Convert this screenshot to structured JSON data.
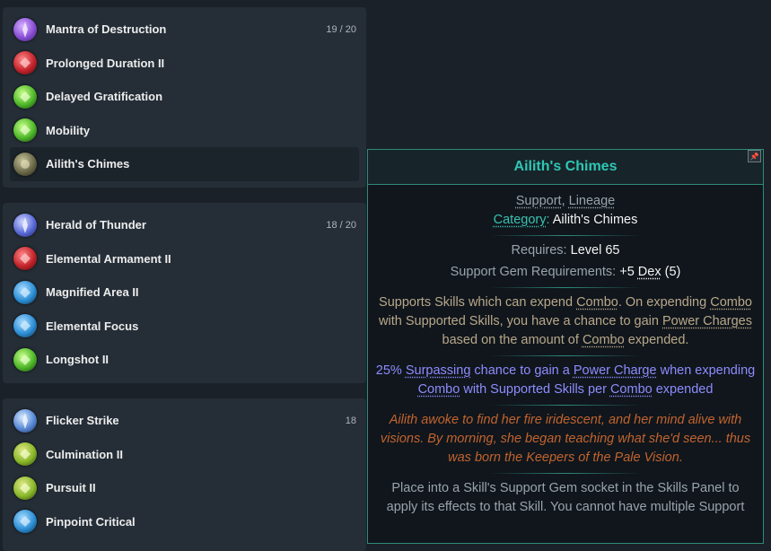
{
  "groups": [
    {
      "count": "19 / 20",
      "items": [
        {
          "name": "Mantra of Destruction",
          "icon": "purple-skill-gem-icon"
        },
        {
          "name": "Prolonged Duration II",
          "icon": "red-support-gem-icon"
        },
        {
          "name": "Delayed Gratification",
          "icon": "green-support-gem-icon"
        },
        {
          "name": "Mobility",
          "icon": "green-support-gem-icon"
        },
        {
          "name": "Ailith's Chimes",
          "icon": "lineage-support-gem-icon"
        }
      ]
    },
    {
      "count": "18 / 20",
      "items": [
        {
          "name": "Herald of Thunder",
          "icon": "blue-skill-gem-icon"
        },
        {
          "name": "Elemental Armament II",
          "icon": "red-support-gem-icon"
        },
        {
          "name": "Magnified Area II",
          "icon": "blue-support-gem-icon"
        },
        {
          "name": "Elemental Focus",
          "icon": "blue-support-gem-icon"
        },
        {
          "name": "Longshot II",
          "icon": "green-support-gem-icon"
        }
      ]
    },
    {
      "count": "18",
      "items": [
        {
          "name": "Flicker Strike",
          "icon": "blue-skill-gem-icon"
        },
        {
          "name": "Culmination II",
          "icon": "green-support-gem-icon"
        },
        {
          "name": "Pursuit II",
          "icon": "green-support-gem-icon"
        },
        {
          "name": "Pinpoint Critical",
          "icon": "blue-support-gem-icon"
        }
      ]
    }
  ],
  "tooltip": {
    "title": "Ailith's Chimes",
    "pin_icon": "pin-icon",
    "tags_support": "Support",
    "tags_sep": ", ",
    "tags_lineage": "Lineage",
    "category_label": "Category",
    "category_colon": ": ",
    "category_value": "Ailith's Chimes",
    "requires_label": "Requires: ",
    "requires_value": "Level 65",
    "gem_req_label": "Support Gem Requirements: ",
    "gem_req_value": "+5 ",
    "gem_req_stat": "Dex",
    "gem_req_extra": " (5)",
    "desc_1": "Supports Skills which can expend ",
    "desc_combo1": "Combo",
    "desc_2": ". On expending ",
    "desc_combo2": "Combo",
    "desc_3": " with Supported Skills, you have a chance to gain ",
    "desc_power": "Power Charges",
    "desc_4": " based on the amount of ",
    "desc_combo3": "Combo",
    "desc_5": " expended.",
    "mod_1": "25% ",
    "mod_surpassing": "Surpassing",
    "mod_2": " chance to gain a ",
    "mod_power": "Power Charge",
    "mod_3": " when expending ",
    "mod_combo1": "Combo",
    "mod_4": " with Supported Skills per ",
    "mod_combo2": "Combo",
    "mod_5": " expended",
    "lore": "Ailith awoke to find her fire iridescent, and her mind alive with visions. By morning, she began teaching what she'd seen... thus was born the Keepers of the Pale Vision.",
    "help": "Place into a Skill's Support Gem socket in the Skills Panel to apply its effects to that Skill. You cannot have multiple Support"
  },
  "colors": {
    "purple": "#8a4fd6",
    "red": "#c4232b",
    "green": "#4fb82a",
    "blue": "#2d8fd6",
    "lineage": "#6b6a4a"
  }
}
